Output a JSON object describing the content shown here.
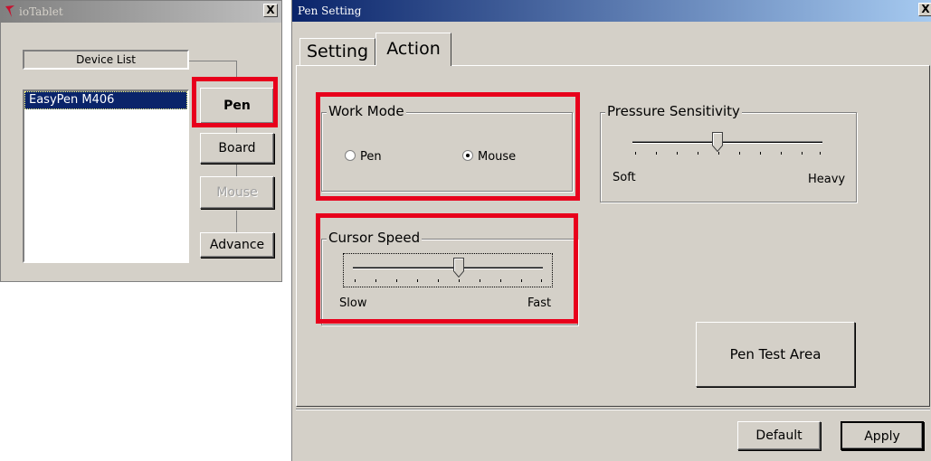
{
  "left_window": {
    "title": "ioTablet",
    "close_label": "X",
    "device_list_label": "Device List",
    "devices": [
      "EasyPen M406"
    ],
    "buttons": {
      "pen": "Pen",
      "board": "Board",
      "mouse": "Mouse",
      "advance": "Advance"
    }
  },
  "right_window": {
    "title": "Pen Setting",
    "close_label": "X",
    "tabs": [
      {
        "label": "Setting",
        "selected": false
      },
      {
        "label": "Action",
        "selected": true
      }
    ],
    "work_mode": {
      "label": "Work Mode",
      "options": [
        "Pen",
        "Mouse"
      ],
      "selected": "Mouse"
    },
    "pressure": {
      "label": "Pressure Sensitivity",
      "min_label": "Soft",
      "max_label": "Heavy",
      "level": 0.45
    },
    "cursor_speed": {
      "label": "Cursor Speed",
      "min_label": "Slow",
      "max_label": "Fast",
      "level": 0.55
    },
    "pen_test_label": "Pen Test Area",
    "default_label": "Default",
    "apply_label": "Apply"
  },
  "colors": {
    "highlight": "#e8001c",
    "selection": "#0a246a",
    "face": "#d4d0c8"
  }
}
